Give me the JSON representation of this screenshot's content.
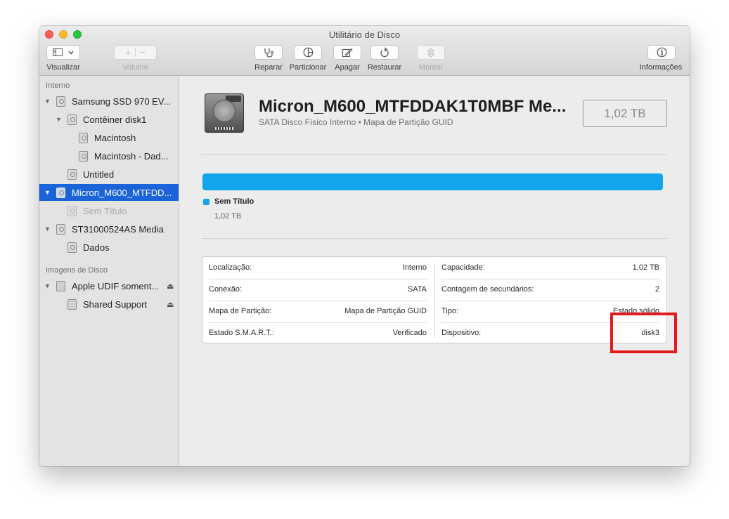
{
  "window": {
    "title": "Utilitário de Disco"
  },
  "toolbar": {
    "view_label": "Visualizar",
    "volume_label": "Volume",
    "volume_add": "+",
    "volume_remove": "−",
    "repair_label": "Reparar",
    "partition_label": "Particionar",
    "erase_label": "Apagar",
    "restore_label": "Restaurar",
    "mount_label": "Montar",
    "info_label": "Informações"
  },
  "icons": {
    "view": "sidebar-view-icon",
    "repair": "stethoscope-icon",
    "partition": "pie-partition-icon",
    "erase": "erase-icon",
    "restore": "restore-icon",
    "mount": "mount-icon",
    "info": "info-icon",
    "eject": "eject-icon"
  },
  "sidebar": {
    "section_internal": "Interno",
    "section_images": "Imagens de Disco",
    "items": [
      {
        "label": "Samsung SSD 970 EV..."
      },
      {
        "label": "Contêiner disk1"
      },
      {
        "label": "Macintosh"
      },
      {
        "label": "Macintosh - Dad..."
      },
      {
        "label": "Untitled"
      },
      {
        "label": "Micron_M600_MTFDD..."
      },
      {
        "label": "Sem Título"
      },
      {
        "label": "ST31000524AS Media"
      },
      {
        "label": "Dados"
      },
      {
        "label": "Apple UDIF soment..."
      },
      {
        "label": "Shared Support"
      }
    ],
    "disclosure": "▼",
    "eject": "⏏"
  },
  "disk": {
    "name": "Micron_M600_MTFDDAK1T0MBF Me...",
    "subtitle": "SATA Disco Físico Interno • Mapa de Partição GUID",
    "capacity": "1,02 TB"
  },
  "usage": {
    "fraction_used": 1.0,
    "partition_name": "Sem Título",
    "partition_size": "1,02 TB",
    "color": "#12a5eb"
  },
  "info": {
    "rows": [
      {
        "k1": "Localização:",
        "v1": "Interno",
        "k2": "Capacidade:",
        "v2": "1,02 TB"
      },
      {
        "k1": "Conexão:",
        "v1": "SATA",
        "k2": "Contagem de secundários:",
        "v2": "2"
      },
      {
        "k1": "Mapa de Partição:",
        "v1": "Mapa de Partição GUID",
        "k2": "Tipo:",
        "v2": "Estado sólido"
      },
      {
        "k1": "Estado S.M.A.R.T.:",
        "v1": "Verificado",
        "k2": "Dispositivo:",
        "v2": "disk3"
      }
    ]
  },
  "colors": {
    "selection": "#1a63d8",
    "highlight": "#e21b1b"
  }
}
